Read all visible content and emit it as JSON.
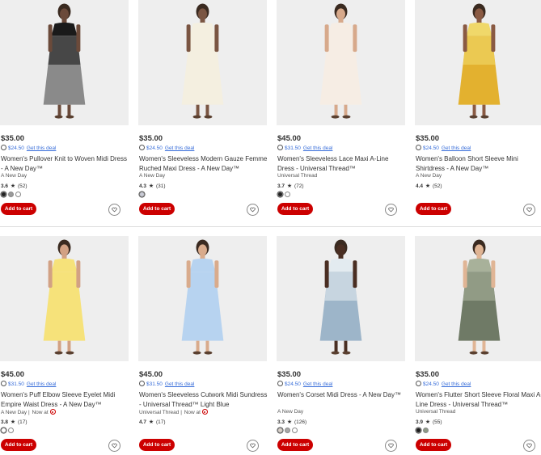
{
  "products": [
    {
      "price": "$35.00",
      "deal_amount": "$24.50",
      "deal_link": "Get this deal",
      "title": "Women's Pullover Knit to Woven Midi Dress - A New Day™",
      "brand": "A New Day",
      "now_at": "",
      "rating": "3.6",
      "reviews": "(52)",
      "swatches": [
        "#222222",
        "#9a9a9a",
        "#ffffff"
      ],
      "add_label": "Add to cart",
      "dress": "#1a1a1a",
      "dress2": "#8a8a8a",
      "skin": "#6b4a3a"
    },
    {
      "price": "$35.00",
      "deal_amount": "$24.50",
      "deal_link": "Get this deal",
      "title": "Women's Sleeveless Modern Gauze Femme Ruched Maxi Dress - A New Day™",
      "brand": "A New Day",
      "now_at": "",
      "rating": "4.3",
      "reviews": "(31)",
      "swatches": [
        "#c9cbd6"
      ],
      "add_label": "Add to cart",
      "dress": "#f4efe0",
      "dress2": "#f4efe0",
      "skin": "#7a5542"
    },
    {
      "price": "$45.00",
      "deal_amount": "$31.50",
      "deal_link": "Get this deal",
      "title": "Women's Sleeveless Lace Maxi A-Line Dress - Universal Thread™",
      "brand": "Universal Thread",
      "now_at": "",
      "rating": "3.7",
      "reviews": "(72)",
      "swatches": [
        "#222222",
        "#ffffff"
      ],
      "add_label": "Add to cart",
      "dress": "#f6ede4",
      "dress2": "#f6ede4",
      "skin": "#d7a98b"
    },
    {
      "price": "$35.00",
      "deal_amount": "$24.50",
      "deal_link": "Get this deal",
      "title": "Women's Balloon Short Sleeve Mini Shirtdress - A New Day™",
      "brand": "A New Day",
      "now_at": "",
      "rating": "4.4",
      "reviews": "(52)",
      "swatches": [],
      "add_label": "Add to cart",
      "dress": "#f0d86a",
      "dress2": "#e3b12f",
      "skin": "#8a5a43"
    },
    {
      "price": "$45.00",
      "deal_amount": "$31.50",
      "deal_link": "Get this deal",
      "title": "Women's Puff Elbow Sleeve Eyelet Midi Empire Waist Dress - A New Day™",
      "brand": "A New Day",
      "now_at": "Now at",
      "rating": "3.8",
      "reviews": "(17)",
      "swatches": [
        "#ffffff",
        "#ffffff"
      ],
      "add_label": "Add to cart",
      "dress": "#f6e27a",
      "dress2": "#f6e27a",
      "skin": "#d2a184"
    },
    {
      "price": "$45.00",
      "deal_amount": "$31.50",
      "deal_link": "Get this deal",
      "title": "Women's Sleeveless Cutwork Midi Sundress - Universal Thread™ Light Blue",
      "brand": "Universal Thread",
      "now_at": "Now at",
      "rating": "4.7",
      "reviews": "(17)",
      "swatches": [],
      "add_label": "Add to cart",
      "dress": "#b7d3f0",
      "dress2": "#b7d3f0",
      "skin": "#d9ab8c"
    },
    {
      "price": "$35.00",
      "deal_amount": "$24.50",
      "deal_link": "Get this deal",
      "title": "Women's Corset Midi Dress - A New Day™",
      "brand": "A New Day",
      "now_at": "",
      "rating": "3.3",
      "reviews": "(126)",
      "swatches": [
        "#d9d0c8",
        "#a8a8a8",
        "#ffffff"
      ],
      "add_label": "Add to cart",
      "dress": "#e3ebf0",
      "dress2": "#9db5c9",
      "skin": "#4a2e22"
    },
    {
      "price": "$35.00",
      "deal_amount": "$24.50",
      "deal_link": "Get this deal",
      "title": "Women's Flutter Short Sleeve Floral Maxi A-Line Dress - Universal Thread™",
      "brand": "Universal Thread",
      "now_at": "",
      "rating": "3.9",
      "reviews": "(55)",
      "swatches": [
        "#1c1c1c",
        "#8e9a86"
      ],
      "add_label": "Add to cart",
      "dress": "#a8b19a",
      "dress2": "#6f7a66",
      "skin": "#e0b595"
    }
  ]
}
